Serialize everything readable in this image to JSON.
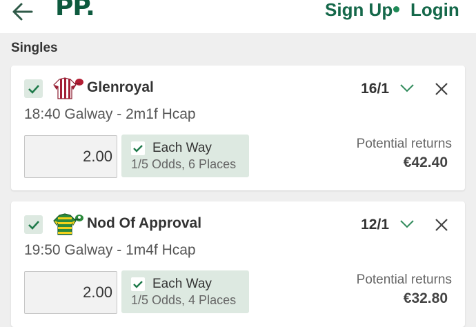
{
  "header": {
    "logo": "PP",
    "logo_dot": ".",
    "sign_up": "Sign Up",
    "login": "Login"
  },
  "section_title": "Singles",
  "bets": [
    {
      "runner": "Glenroyal",
      "odds": "16/1",
      "event": "18:40 Galway - 2m1f Hcap",
      "stake": "2.00",
      "each_way": {
        "label": "Each Way",
        "terms": "1/5 Odds, 6 Places",
        "checked": true
      },
      "returns_label": "Potential returns",
      "returns_value": "€42.40",
      "silk_icon": "silk-maroon-stripes"
    },
    {
      "runner": "Nod Of Approval",
      "odds": "12/1",
      "event": "19:50 Galway - 1m4f Hcap",
      "stake": "2.00",
      "each_way": {
        "label": "Each Way",
        "terms": "1/5 Odds, 4 Places",
        "checked": true
      },
      "returns_label": "Potential returns",
      "returns_value": "€32.80",
      "silk_icon": "silk-green-yellow-hoops"
    }
  ],
  "colors": {
    "brand": "#0d5a3e",
    "accent": "#1e8a57",
    "check_bg": "#dde9e1"
  }
}
